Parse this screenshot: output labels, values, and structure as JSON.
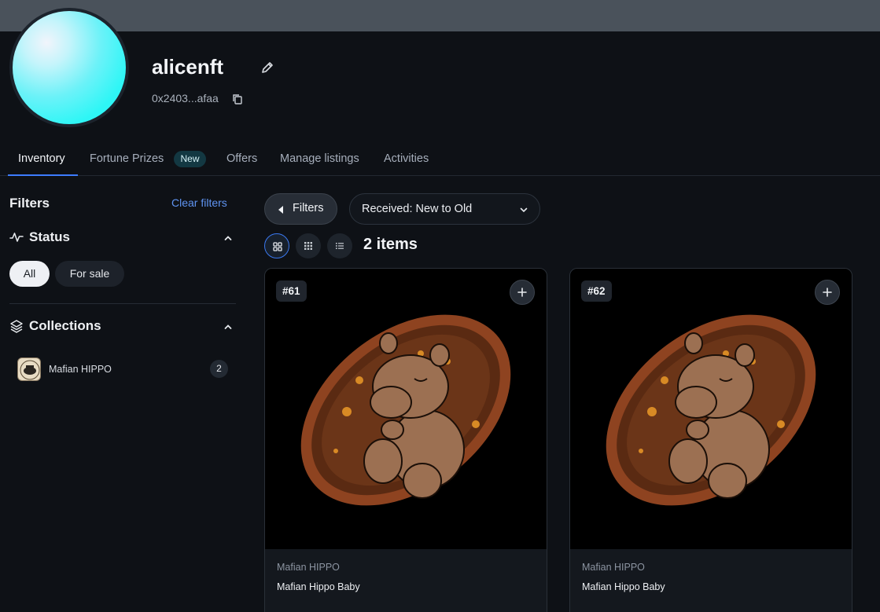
{
  "profile": {
    "username": "alicenft",
    "address": "0x2403...afaa"
  },
  "tabs": [
    {
      "label": "Inventory",
      "active": true
    },
    {
      "label": "Fortune Prizes",
      "badge": "New"
    },
    {
      "label": "Offers"
    },
    {
      "label": "Manage listings"
    },
    {
      "label": "Activities"
    }
  ],
  "sidebar": {
    "title": "Filters",
    "clear_label": "Clear filters",
    "status": {
      "title": "Status",
      "options": [
        "All",
        "For sale"
      ],
      "selected": "All"
    },
    "collections": {
      "title": "Collections",
      "items": [
        {
          "name": "Mafian HIPPO",
          "count": "2"
        }
      ]
    }
  },
  "toolbar": {
    "filters_label": "Filters",
    "sort_value": "Received: New to Old",
    "items_count": "2 items"
  },
  "cards": [
    {
      "number": "#61",
      "collection": "Mafian HIPPO",
      "name": "Mafian Hippo Baby"
    },
    {
      "number": "#62",
      "collection": "Mafian HIPPO",
      "name": "Mafian Hippo Baby"
    }
  ],
  "colors": {
    "accent": "#3d7cff",
    "link": "#5f94f2",
    "background": "#0e1116"
  },
  "icons": [
    "edit-icon",
    "copy-icon",
    "activity-icon",
    "layers-icon",
    "chevron-up-icon",
    "chevron-down-icon",
    "caret-left-icon",
    "grid-large-icon",
    "grid-small-icon",
    "list-icon",
    "plus-icon"
  ]
}
